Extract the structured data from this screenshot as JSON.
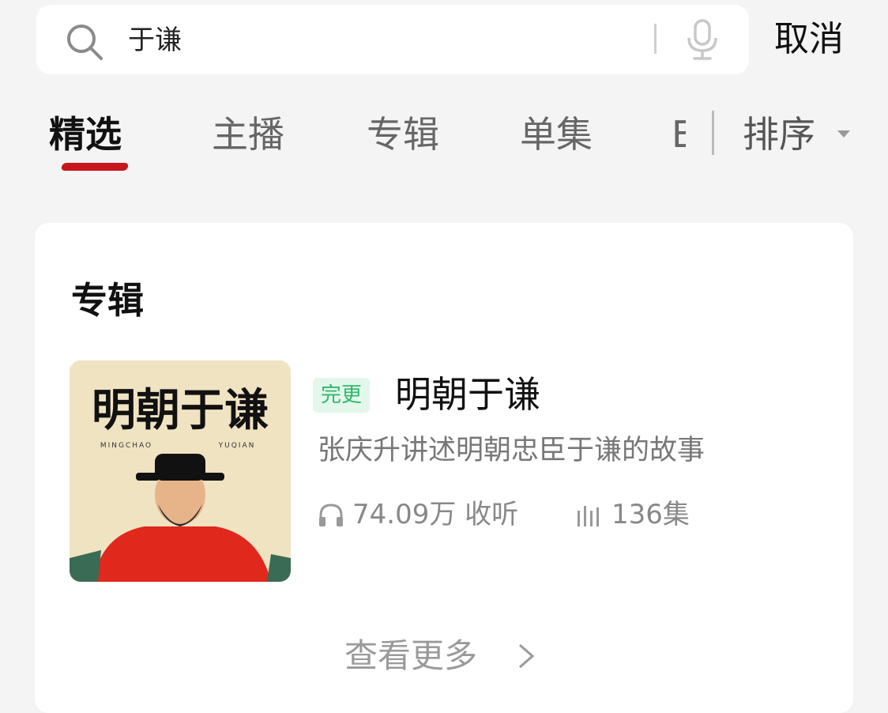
{
  "search": {
    "query": "于谦",
    "cancel_label": "取消"
  },
  "tabs": [
    {
      "label": "精选"
    },
    {
      "label": "主播"
    },
    {
      "label": "专辑"
    },
    {
      "label": "单集"
    },
    {
      "label": "E"
    }
  ],
  "sort_label": "排序",
  "section_title": "专辑",
  "album": {
    "cover_title": "明朝于谦",
    "cover_subtitle_left": "MINGCHAO",
    "cover_subtitle_right": "YUQIAN",
    "badge": "完更",
    "title": "明朝于谦",
    "description": "张庆升讲述明朝忠臣于谦的故事",
    "plays": "74.09万 收听",
    "episodes": "136集"
  },
  "more_label": "查看更多",
  "colors": {
    "accent": "#c8161d",
    "badge_text": "#2fb86a",
    "badge_bg": "#e3f7ea"
  }
}
